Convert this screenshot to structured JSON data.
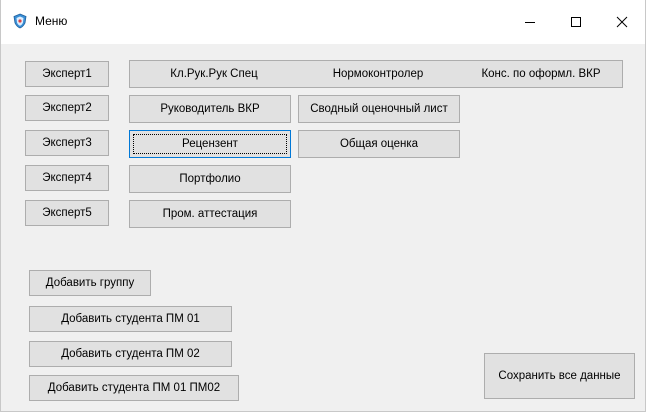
{
  "window": {
    "title": "Меню",
    "icon": "shield-icon",
    "controls": [
      "minimize-icon",
      "maximize-icon",
      "close-icon"
    ]
  },
  "experts": {
    "expert1": "Эксперт1",
    "expert2": "Эксперт2",
    "expert3": "Эксперт3",
    "expert4": "Эксперт4",
    "expert5": "Эксперт5"
  },
  "roles": {
    "kl_ruk_spec": "Кл.Рук.Рук Спец",
    "normocontroler": "Нормоконтролер",
    "kons_vkr": "Конс. по оформл. ВКР",
    "rukovoditel_vkr": "Руководитель ВКР",
    "svodny_list": "Сводный оценочный лист",
    "recenzent": "Рецензент",
    "obshaya_ocenka": "Общая оценка",
    "portfolio": "Портфолио",
    "prom_attestacia": "Пром. аттестация"
  },
  "actions": {
    "add_group": "Добавить группу",
    "add_student_pm01": "Добавить студента ПМ 01",
    "add_student_pm02": "Добавить студента ПМ 02",
    "add_student_pm01_pm02": "Добавить студента ПМ 01 ПМ02",
    "save_all": "Сохранить все данные"
  },
  "colors": {
    "window_bg": "#f0f0f0",
    "button_bg": "#e1e1e1",
    "button_border": "#adadad",
    "focus_border": "#0078d7"
  }
}
